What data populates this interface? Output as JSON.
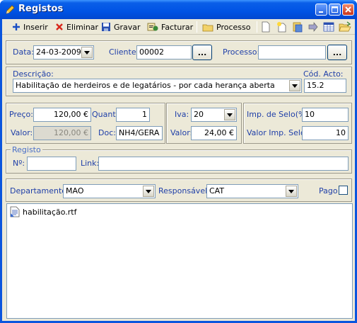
{
  "window": {
    "title": "Registos"
  },
  "toolbar": {
    "inserir": "Inserir",
    "eliminar": "Eliminar",
    "gravar": "Gravar",
    "facturar": "Facturar",
    "processo": "Processo"
  },
  "header_row": {
    "data_label": "Data:",
    "data_value": "24-03-2009",
    "cliente_label": "Cliente:",
    "cliente_value": "00002",
    "ellipsis": "...",
    "processo_label": "Processo:",
    "processo_value": ""
  },
  "descricao": {
    "label": "Descrição:",
    "value": "Habilitação de herdeiros e de legatários - por cada herança aberta",
    "cod_label": "Cód. Acto:",
    "cod_value": "15.2"
  },
  "prices": {
    "preco_label": "Preço:",
    "preco_value": "120,00 €",
    "quant_label": "Quant:",
    "quant_value": "1",
    "valor_label": "Valor:",
    "valor_value": "120,00 €",
    "doc_label": "Doc:",
    "doc_value": "NH4/GERA",
    "iva_label": "Iva:",
    "iva_value": "20",
    "iva_valor_label": "Valor:",
    "iva_valor_value": "24,00 €",
    "selo_label": "Imp. de Selo(%):",
    "selo_value": "10",
    "selo_valor_label": "Valor Imp. Selo:",
    "selo_valor_value": "10"
  },
  "registo": {
    "group_label": "Registo",
    "num_label": "Nº:",
    "num_value": "",
    "link_label": "Link:",
    "link_value": ""
  },
  "bottom": {
    "departamento_label": "Departamento:",
    "departamento_value": "MAO",
    "responsavel_label": "Responsável:",
    "responsavel_value": "CAT",
    "pago_label": "Pago",
    "pago_checked": false
  },
  "files": [
    {
      "name": "habilitação.rtf"
    }
  ]
}
